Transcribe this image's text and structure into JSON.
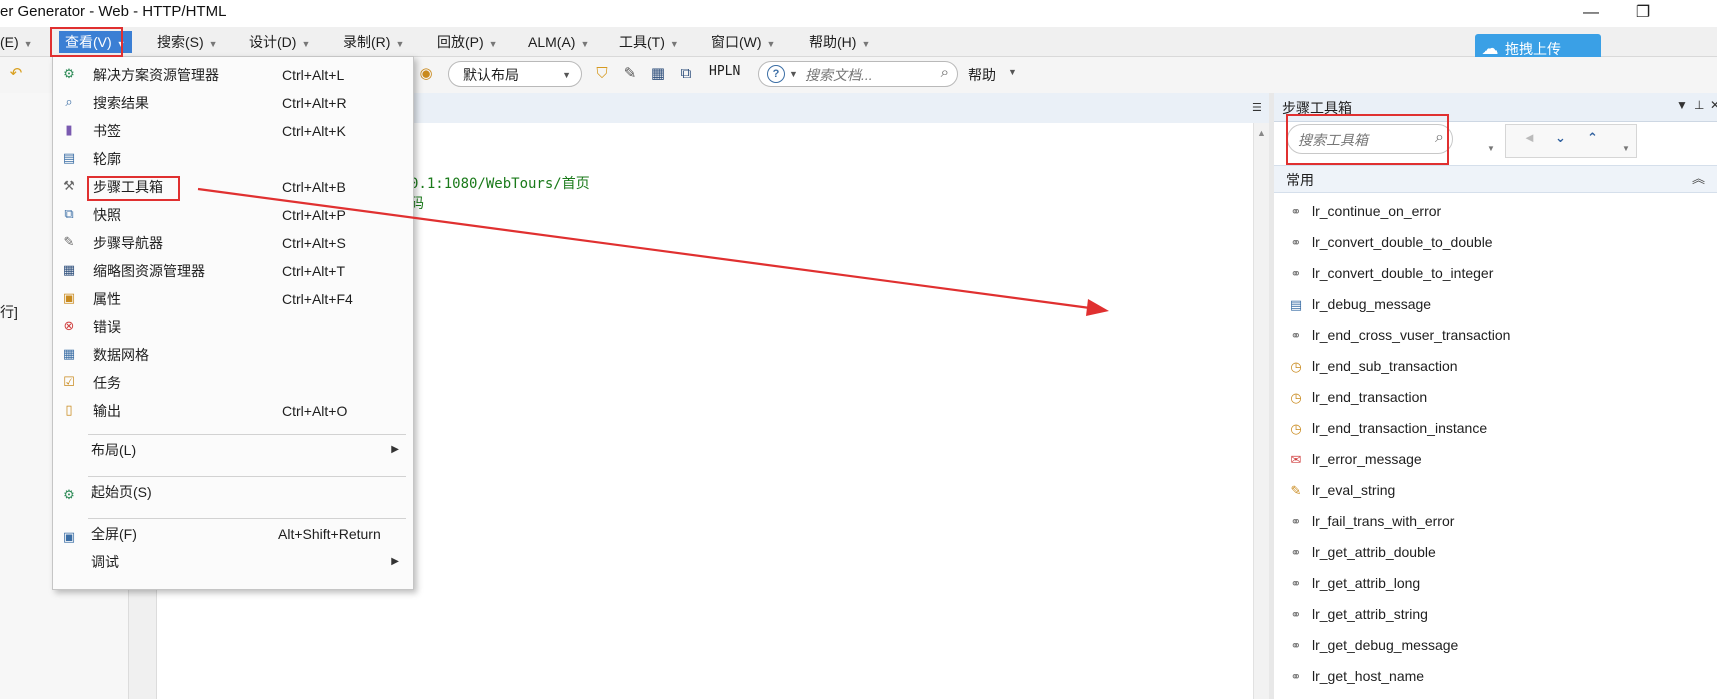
{
  "window": {
    "title": "er Generator - Web - HTTP/HTML",
    "minimize_icon": "minimize-icon",
    "restore_icon": "restore-icon"
  },
  "menubar": {
    "items": [
      {
        "label": "(E)"
      },
      {
        "label": "查看(V)"
      },
      {
        "label": "搜索(S)"
      },
      {
        "label": "设计(D)"
      },
      {
        "label": "录制(R)"
      },
      {
        "label": "回放(P)"
      },
      {
        "label": "ALM(A)"
      },
      {
        "label": "工具(T)"
      },
      {
        "label": "窗口(W)"
      },
      {
        "label": "帮助(H)"
      }
    ],
    "upload_button": "拖拽上传"
  },
  "toolbar": {
    "layout_select": "默认布局",
    "hpln": "HPLN",
    "doc_search_placeholder": "搜索文档...",
    "help_label": "帮助"
  },
  "left_panel": {
    "label": "行]"
  },
  "editor": {
    "lines": [
      "0.1:1080/WebTours/首页",
      "码"
    ]
  },
  "view_menu": {
    "items": [
      {
        "label": "解决方案资源管理器",
        "shortcut": "Ctrl+Alt+L",
        "icon": "solution-explorer-icon"
      },
      {
        "label": "搜索结果",
        "shortcut": "Ctrl+Alt+R",
        "icon": "search-results-icon"
      },
      {
        "label": "书签",
        "shortcut": "Ctrl+Alt+K",
        "icon": "bookmark-icon"
      },
      {
        "label": "轮廓",
        "shortcut": "",
        "icon": "outline-icon"
      },
      {
        "label": "步骤工具箱",
        "shortcut": "Ctrl+Alt+B",
        "icon": "step-toolbox-icon"
      },
      {
        "label": "快照",
        "shortcut": "Ctrl+Alt+P",
        "icon": "snapshot-icon"
      },
      {
        "label": "步骤导航器",
        "shortcut": "Ctrl+Alt+S",
        "icon": "step-navigator-icon"
      },
      {
        "label": "缩略图资源管理器",
        "shortcut": "Ctrl+Alt+T",
        "icon": "thumbnail-explorer-icon"
      },
      {
        "label": "属性",
        "shortcut": "Ctrl+Alt+F4",
        "icon": "properties-icon"
      },
      {
        "label": "错误",
        "shortcut": "",
        "icon": "errors-icon"
      },
      {
        "label": "数据网格",
        "shortcut": "",
        "icon": "data-grid-icon"
      },
      {
        "label": "任务",
        "shortcut": "",
        "icon": "tasks-icon"
      },
      {
        "label": "输出",
        "shortcut": "Ctrl+Alt+O",
        "icon": "output-icon"
      }
    ],
    "layout": {
      "label": "布局(L)"
    },
    "start_page": {
      "label": "起始页(S)",
      "icon": "start-page-icon"
    },
    "fullscreen": {
      "label": "全屏(F)",
      "shortcut": "Alt+Shift+Return",
      "icon": "fullscreen-icon"
    },
    "debug": {
      "label": "调试"
    }
  },
  "toolbox": {
    "title": "步骤工具箱",
    "search_placeholder": "搜索工具箱",
    "category": "常用",
    "items": [
      {
        "name": "lr_continue_on_error",
        "icon": "link-icon"
      },
      {
        "name": "lr_convert_double_to_double",
        "icon": "link-icon"
      },
      {
        "name": "lr_convert_double_to_integer",
        "icon": "link-icon"
      },
      {
        "name": "lr_debug_message",
        "icon": "debug-message-icon"
      },
      {
        "name": "lr_end_cross_vuser_transaction",
        "icon": "link-icon"
      },
      {
        "name": "lr_end_sub_transaction",
        "icon": "transaction-icon"
      },
      {
        "name": "lr_end_transaction",
        "icon": "transaction-icon"
      },
      {
        "name": "lr_end_transaction_instance",
        "icon": "transaction-icon"
      },
      {
        "name": "lr_error_message",
        "icon": "error-message-icon"
      },
      {
        "name": "lr_eval_string",
        "icon": "pencil-icon"
      },
      {
        "name": "lr_fail_trans_with_error",
        "icon": "link-icon"
      },
      {
        "name": "lr_get_attrib_double",
        "icon": "link-icon"
      },
      {
        "name": "lr_get_attrib_long",
        "icon": "link-icon"
      },
      {
        "name": "lr_get_attrib_string",
        "icon": "link-icon"
      },
      {
        "name": "lr_get_debug_message",
        "icon": "link-icon"
      },
      {
        "name": "lr_get_host_name",
        "icon": "link-icon"
      }
    ]
  },
  "colors": {
    "highlight_box": "#e03030",
    "menu_active": "#3b7fd4",
    "code_text": "#1a7a1a",
    "upload_button": "#3aa0e6"
  }
}
